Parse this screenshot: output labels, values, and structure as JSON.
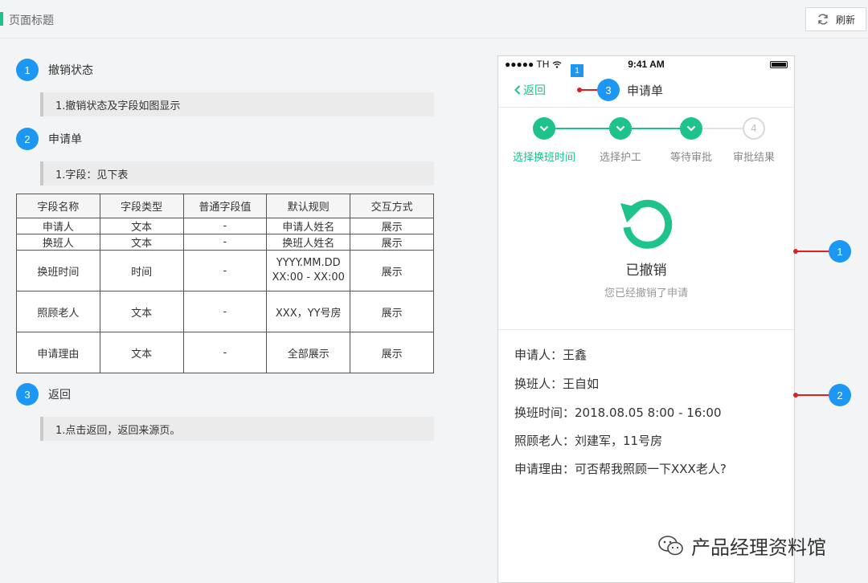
{
  "header": {
    "title": "页面标题",
    "refresh_label": "刷新"
  },
  "spec": {
    "sections": [
      {
        "num": "1",
        "title": "撤销状态",
        "note": "1.撤销状态及字段如图显示"
      },
      {
        "num": "2",
        "title": "申请单",
        "note": "1.字段：见下表"
      },
      {
        "num": "3",
        "title": "返回",
        "note": "1.点击返回，返回来源页。"
      }
    ],
    "table": {
      "columns": [
        "字段名称",
        "字段类型",
        "普通字段值",
        "默认规则",
        "交互方式"
      ],
      "rows": [
        [
          "申请人",
          "文本",
          "-",
          "申请人姓名",
          "展示"
        ],
        [
          "换班人",
          "文本",
          "-",
          "换班人姓名",
          "展示"
        ],
        [
          "换班时间",
          "时间",
          "-",
          "YYYY.MM.DD",
          "展示"
        ],
        [
          "照顾老人",
          "文本",
          "-",
          "XXX，YY号房",
          "展示"
        ],
        [
          "申请理由",
          "文本",
          "-",
          "全部展示",
          "展示"
        ]
      ],
      "row3_rule_line2": "XX:00 - XX:00"
    }
  },
  "phone": {
    "status": {
      "carrier": "●●●●● TH",
      "time": "9:41 AM"
    },
    "nav": {
      "back": "返回",
      "title": "申请单"
    },
    "steps": [
      {
        "label": "选择换班时间",
        "state": "done"
      },
      {
        "label": "选择护工",
        "state": "done"
      },
      {
        "label": "等待审批",
        "state": "done"
      },
      {
        "label": "审批结果",
        "state": "todo",
        "num": "4"
      }
    ],
    "result": {
      "title": "已撤销",
      "subtitle": "您已经撤销了申请"
    },
    "fields": [
      "申请人：王鑫",
      "换班人：王自如",
      "换班时间：2018.08.05  8:00 - 16:00",
      "照顾老人：刘建军，11号房",
      "申请理由：可否帮我照顾一下XXX老人?"
    ]
  },
  "annotations": {
    "a1": "1",
    "a2": "2",
    "a3": "3",
    "square": "1"
  },
  "watermark": "产品经理资料馆",
  "colors": {
    "accent": "#1ec28b",
    "badge": "#1c97f3",
    "annotation": "#e02020"
  }
}
